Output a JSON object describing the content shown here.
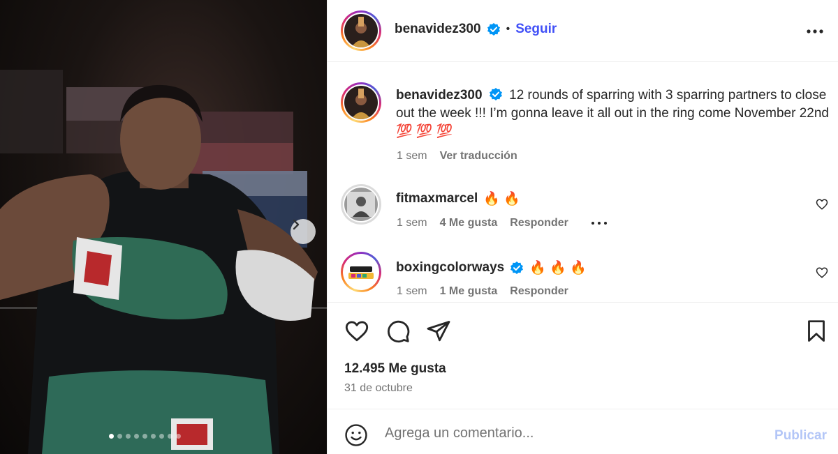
{
  "post": {
    "username": "benavidez300",
    "follow_label": "Seguir",
    "separator": "•",
    "caption": "12 rounds of sparring with 3 sparring partners to close out the week !!! I’m gonna leave it all out in the ring come November 22nd 💯 💯 💯",
    "caption_time": "1 sem",
    "translate_label": "Ver traducción",
    "likes": "12.495 Me gusta",
    "date": "31 de octubre"
  },
  "media": {
    "slide_count": 9,
    "active_slide": 1
  },
  "comments": [
    {
      "username": "fitmaxmarcel",
      "text": "🔥 🔥",
      "time": "1 sem",
      "likes": "4 Me gusta",
      "reply_label": "Responder",
      "verified": false
    },
    {
      "username": "boxingcolorways",
      "text": "🔥 🔥 🔥",
      "time": "1 sem",
      "likes": "1 Me gusta",
      "reply_label": "Responder",
      "verified": true
    }
  ],
  "comment_box": {
    "placeholder": "Agrega un comentario...",
    "publish_label": "Publicar"
  },
  "icons": {
    "verified": "verified-badge-icon",
    "more": "more-options-icon",
    "like": "heart-icon",
    "comment": "comment-bubble-icon",
    "share": "paper-plane-icon",
    "save": "bookmark-icon",
    "emoji": "emoji-smiley-icon",
    "next": "chevron-right-icon"
  },
  "colors": {
    "follow": "#4150f7",
    "verified": "#0095f6",
    "publish_disabled": "#b3c6f7",
    "secondary_text": "#737373"
  }
}
